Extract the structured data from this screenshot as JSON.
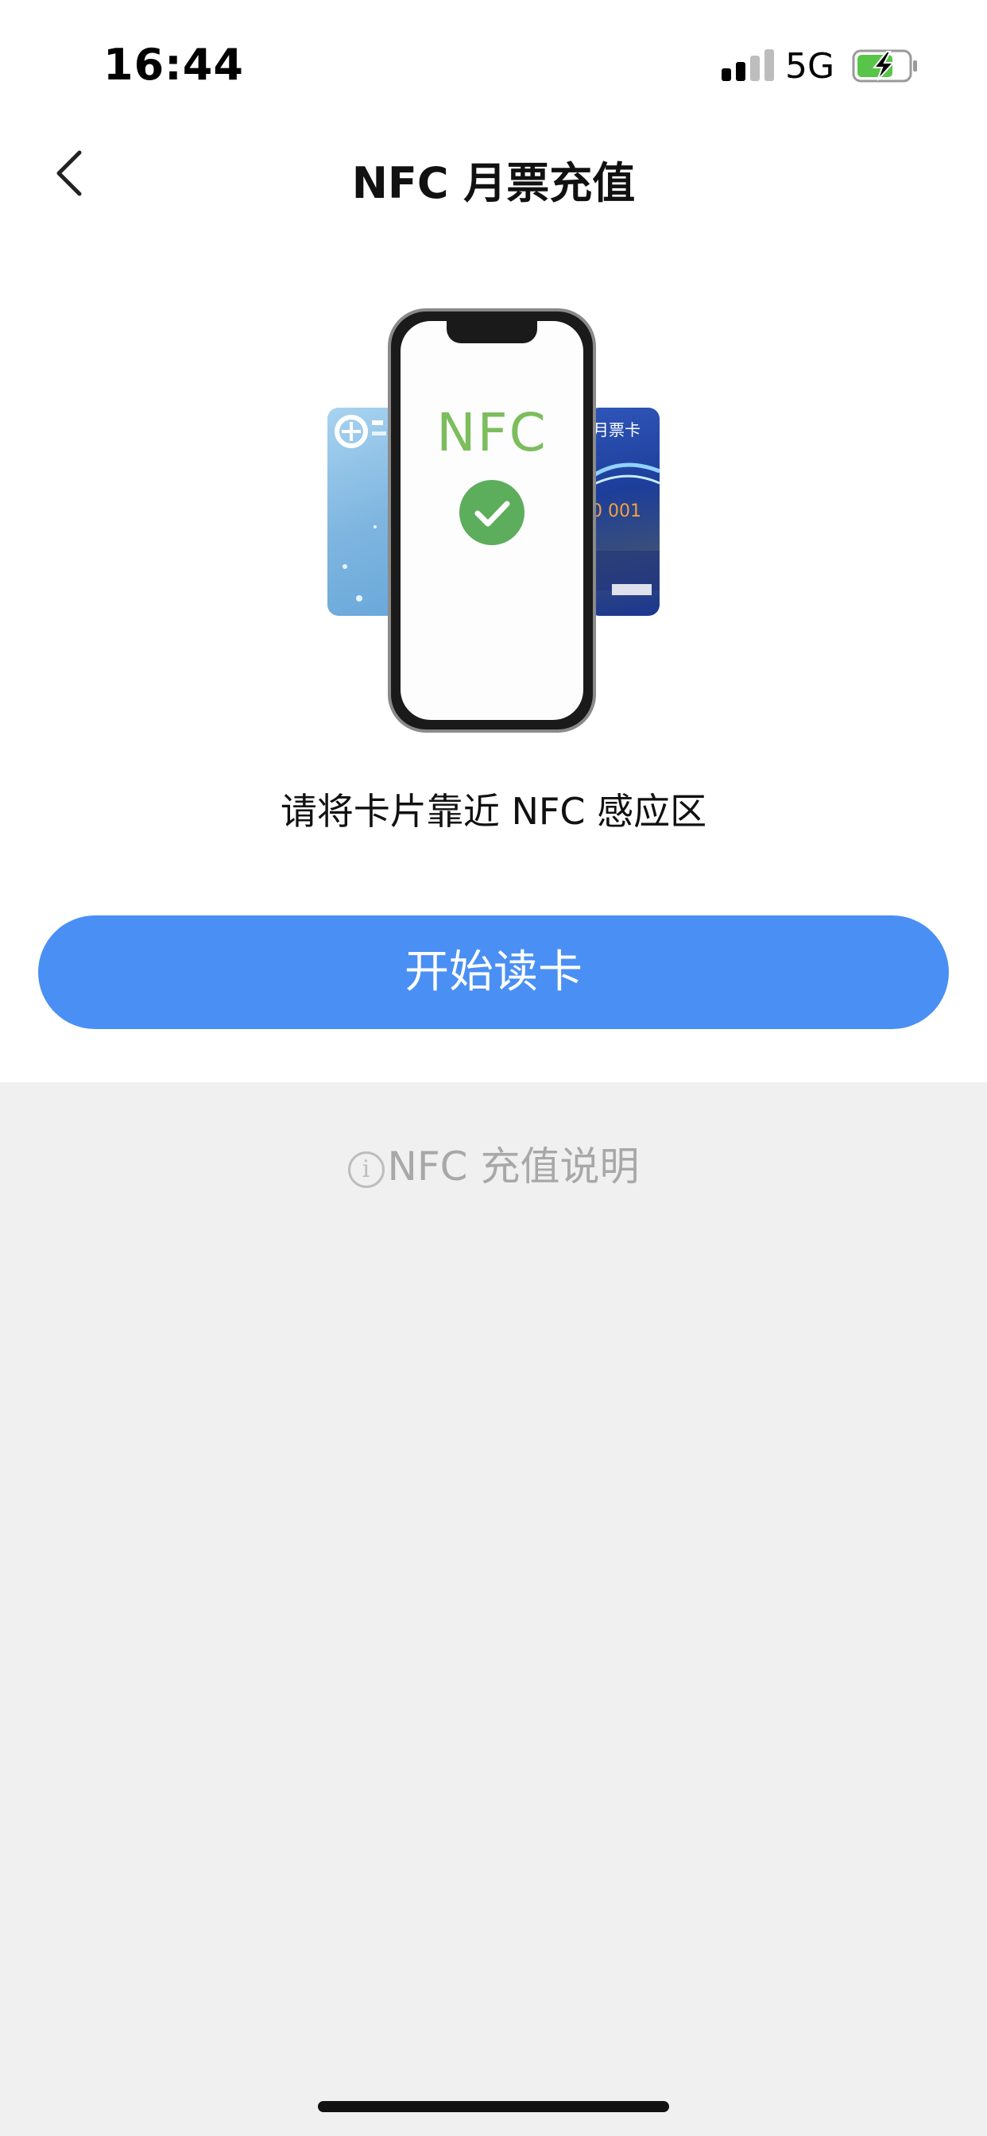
{
  "status_bar": {
    "time": "16:44",
    "network": "5G"
  },
  "nav": {
    "title": "NFC 月票充值"
  },
  "illustration": {
    "phone_text": "NFC",
    "right_card_text": "月票卡",
    "right_card_number": "0 001"
  },
  "hint": "请将卡片靠近 NFC 感应区",
  "primary_button": "开始读卡",
  "info_link": "NFC 充值说明",
  "colors": {
    "accent": "#4a8ff3",
    "nfc_green": "#7cbd5e",
    "check_green": "#5cad5c",
    "battery_green": "#59c44a"
  }
}
